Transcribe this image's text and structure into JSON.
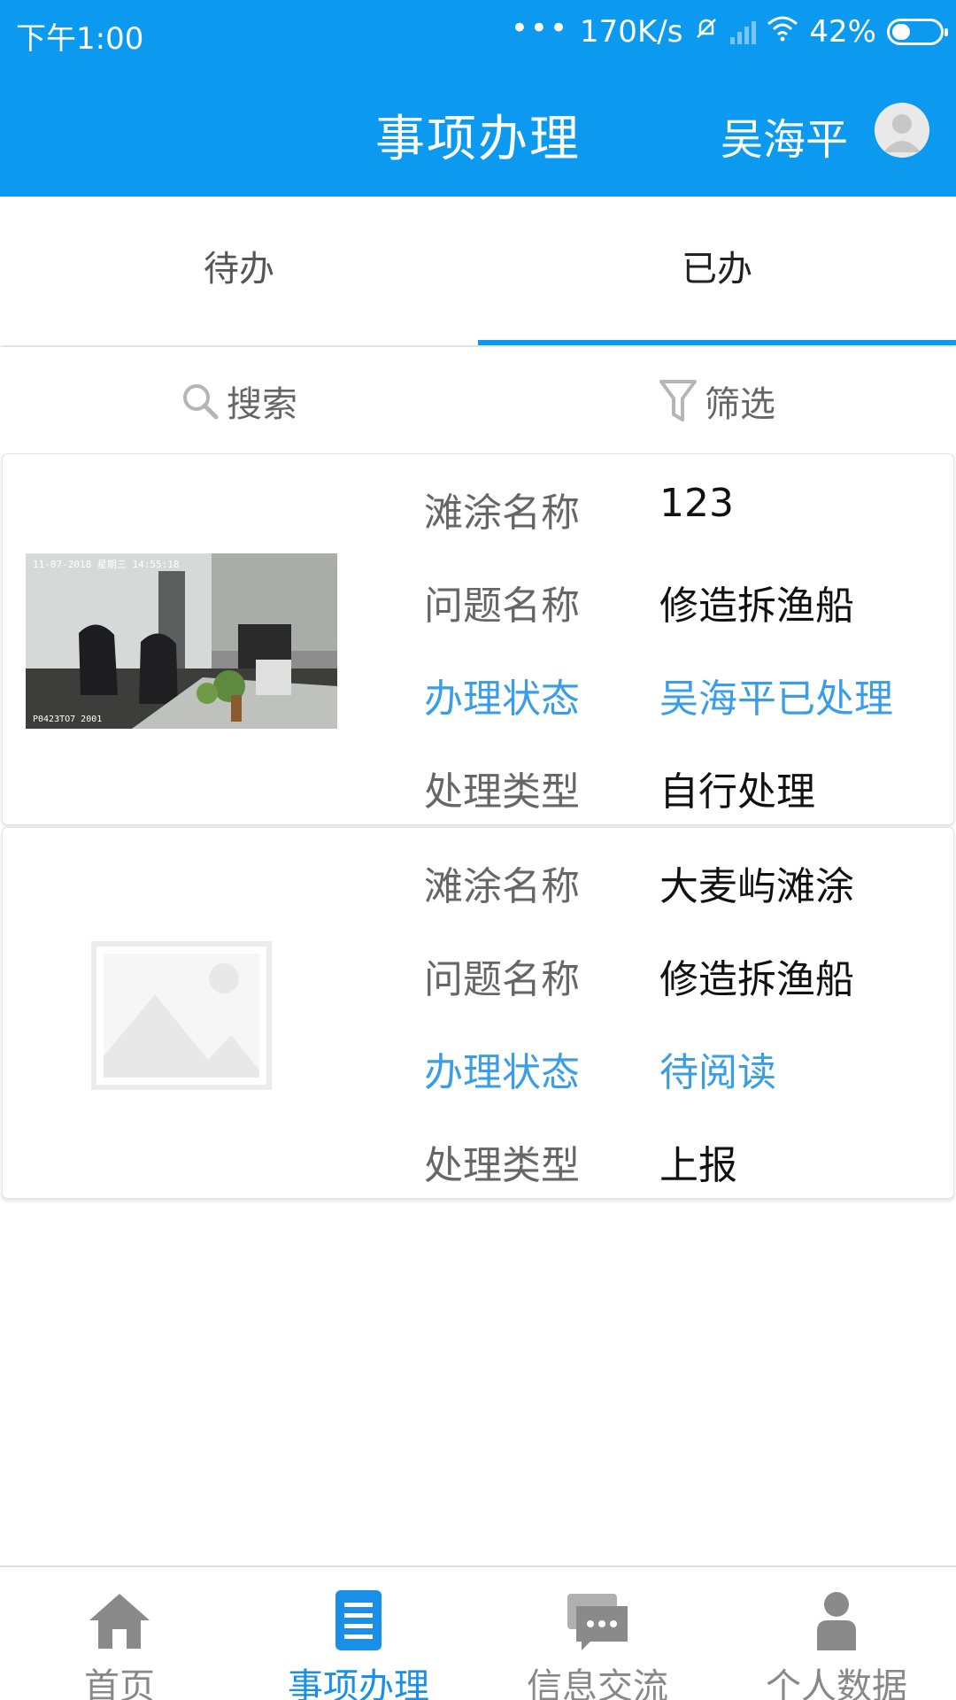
{
  "status_bar": {
    "time": "下午1:00",
    "dots": "•••",
    "speed": "170K/s",
    "battery": "42%",
    "battery_level": 0.42
  },
  "header": {
    "title": "事项办理",
    "user_name": "吴海平"
  },
  "tabs": [
    {
      "label": "待办"
    },
    {
      "label": "已办"
    }
  ],
  "toolbar": {
    "search_label": "搜索",
    "filter_label": "筛选"
  },
  "records": [
    {
      "labels": [
        "滩涂名称",
        "问题名称",
        "办理状态",
        "处理类型"
      ],
      "values": [
        "123",
        "修造拆渔船",
        "吴海平已处理",
        "自行处理"
      ],
      "photo_timestamp": "11-07-2018 星期三 14:55:18",
      "photo_caption": "P0423TO7 2001"
    },
    {
      "labels": [
        "滩涂名称",
        "问题名称",
        "办理状态",
        "处理类型"
      ],
      "values": [
        "大麦屿滩涂",
        "修造拆渔船",
        "待阅读",
        "上报"
      ]
    }
  ],
  "bottom_nav": [
    {
      "label": "首页",
      "icon": "home-icon"
    },
    {
      "label": "事项办理",
      "icon": "document-list-icon"
    },
    {
      "label": "信息交流",
      "icon": "chat-icon"
    },
    {
      "label": "个人数据",
      "icon": "person-icon"
    }
  ],
  "colors": {
    "header_bg": "#0b9af0",
    "accent": "#3a9de8",
    "nav_active": "#1a8fe8"
  }
}
